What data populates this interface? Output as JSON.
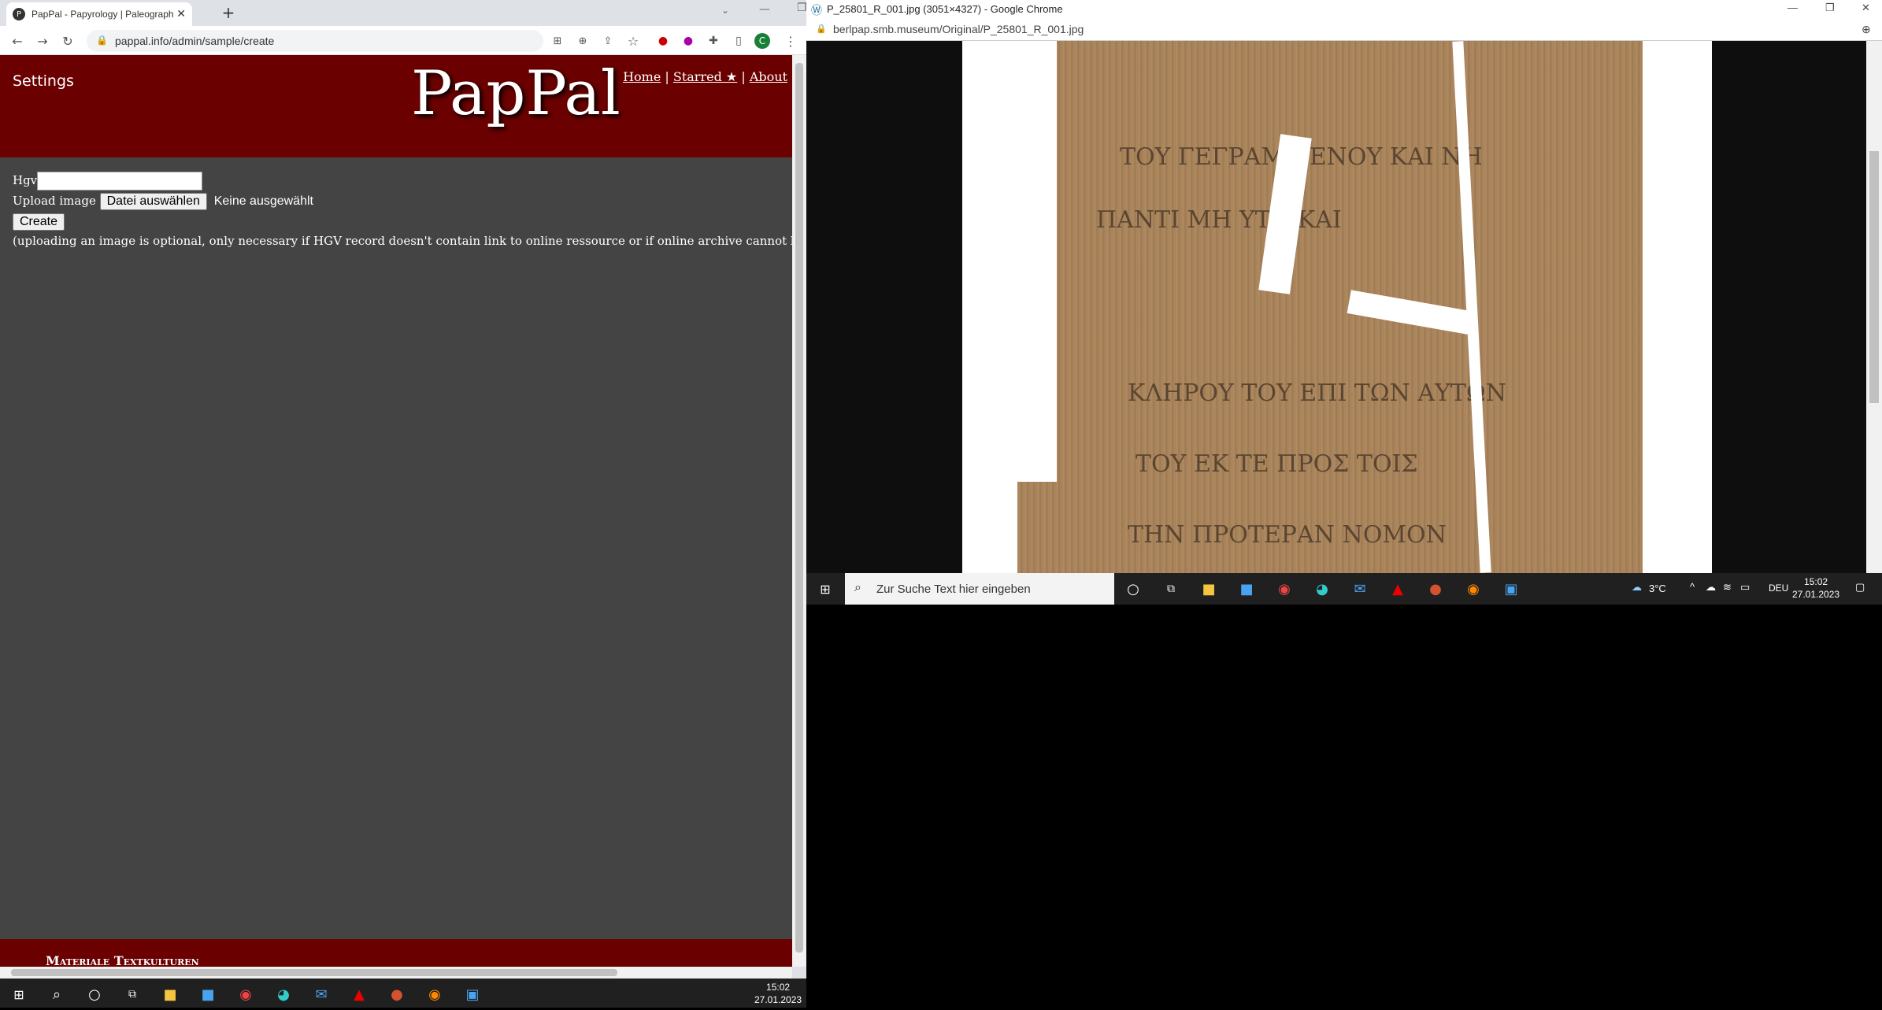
{
  "left_browser": {
    "tab_title": "PapPal - Papyrology | Paleograph",
    "tab_favicon_letter": "P",
    "url": "pappal.info/admin/sample/create",
    "profile_initial": "C"
  },
  "page": {
    "settings_label": "Settings",
    "logo": "PapPal",
    "nav": {
      "home": "Home",
      "sep1": "|",
      "starred": "Starred ★",
      "sep2": "|",
      "about": "About"
    },
    "hgv_label": "Hgv",
    "upload_label": "Upload image",
    "file_button": "Datei auswählen",
    "file_status": "Keine ausgewählt",
    "create_button": "Create",
    "note": "(uploading an image is optional, only necessary if HGV record doesn't contain link to online ressource or if online archive cannot be harveste",
    "footer": "Materiale Textkulturen"
  },
  "right_browser": {
    "title": "P_25801_R_001.jpg (3051×4327) - Google Chrome",
    "url": "berlpap.smb.museum/Original/P_25801_R_001.jpg"
  },
  "right_taskbar": {
    "search_placeholder": "Zur Suche Text hier eingeben",
    "weather": "3°C",
    "lang": "DEU",
    "time": "15:02",
    "date": "27.01.2023"
  },
  "left_taskbar": {
    "time": "15:02",
    "date": "27.01.2023"
  },
  "icons": [
    "windows-icon",
    "search-icon",
    "cortana-icon",
    "task-view-icon",
    "explorer-icon",
    "store-icon",
    "chrome-icon",
    "edge-icon",
    "mail-icon",
    "acrobat-icon",
    "powerpoint-icon",
    "firefox-icon",
    "photos-icon"
  ]
}
